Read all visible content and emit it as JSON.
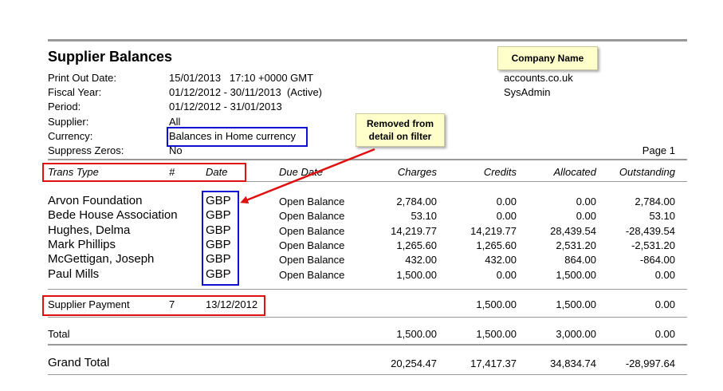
{
  "report": {
    "title": "Supplier Balances",
    "meta": [
      {
        "label": "Print Out Date:",
        "value": "15/01/2013   17:10 +0000 GMT"
      },
      {
        "label": "Fiscal Year:",
        "value": "01/12/2012 - 30/11/2013  (Active)"
      },
      {
        "label": "Period:",
        "value": "01/12/2012 - 31/01/2013"
      },
      {
        "label": "Supplier:",
        "value": "All"
      },
      {
        "label": "Currency:",
        "value": "Balances in Home currency"
      },
      {
        "label": "Suppress Zeros:",
        "value": "No"
      }
    ],
    "company": {
      "domain": "accounts.co.uk",
      "user": "SysAdmin"
    },
    "page": "Page 1"
  },
  "columns": {
    "trans_type": "Trans Type",
    "number": "#",
    "date": "Date",
    "due_date": "Due Date",
    "charges": "Charges",
    "credits": "Credits",
    "allocated": "Allocated",
    "outstanding": "Outstanding"
  },
  "rows": [
    {
      "name": "Arvon Foundation",
      "currency": "GBP",
      "due": "Open Balance",
      "charges": "2,784.00",
      "credits": "0.00",
      "allocated": "0.00",
      "outstanding": "2,784.00"
    },
    {
      "name": "Bede House Association",
      "currency": "GBP",
      "due": "Open Balance",
      "charges": "53.10",
      "credits": "0.00",
      "allocated": "0.00",
      "outstanding": "53.10"
    },
    {
      "name": "Hughes, Delma",
      "currency": "GBP",
      "due": "Open Balance",
      "charges": "14,219.77",
      "credits": "14,219.77",
      "allocated": "28,439.54",
      "outstanding": "-28,439.54"
    },
    {
      "name": "Mark Phillips",
      "currency": "GBP",
      "due": "Open Balance",
      "charges": "1,265.60",
      "credits": "1,265.60",
      "allocated": "2,531.20",
      "outstanding": "-2,531.20"
    },
    {
      "name": "McGettigan, Joseph",
      "currency": "GBP",
      "due": "Open Balance",
      "charges": "432.00",
      "credits": "432.00",
      "allocated": "864.00",
      "outstanding": "-864.00"
    },
    {
      "name": "Paul Mills",
      "currency": "GBP",
      "due": "Open Balance",
      "charges": "1,500.00",
      "credits": "0.00",
      "allocated": "1,500.00",
      "outstanding": "0.00"
    }
  ],
  "payment": {
    "type": "Supplier Payment",
    "number": "7",
    "date": "13/12/2012",
    "credits": "1,500.00",
    "allocated": "1,500.00",
    "outstanding": "0.00"
  },
  "total": {
    "label": "Total",
    "charges": "1,500.00",
    "credits": "1,500.00",
    "allocated": "3,000.00",
    "outstanding": "0.00"
  },
  "grand_total": {
    "label": "Grand Total",
    "charges": "20,254.47",
    "credits": "17,417.37",
    "allocated": "34,834.74",
    "outstanding": "-28,997.64"
  },
  "annotations": {
    "company_note": "Company Name",
    "removed_note_line1": "Removed from",
    "removed_note_line2": "detail on filter"
  },
  "colors": {
    "highlight_red": "#e01010",
    "highlight_blue": "#1010d0",
    "note_bg": "#ffffcc"
  }
}
